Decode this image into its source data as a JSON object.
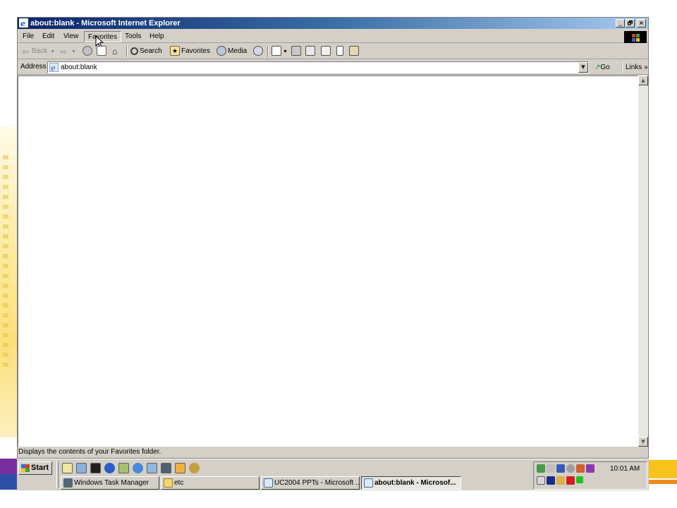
{
  "window": {
    "title": "about:blank - Microsoft Internet Explorer",
    "controls": {
      "minimize": "_",
      "maximize": "🗗",
      "close": "×"
    }
  },
  "menu": {
    "items": [
      {
        "label": "File"
      },
      {
        "label": "Edit"
      },
      {
        "label": "View"
      },
      {
        "label": "Favorites",
        "active": true
      },
      {
        "label": "Tools"
      },
      {
        "label": "Help"
      }
    ]
  },
  "toolbar": {
    "back": "Back",
    "search": "Search",
    "favorites": "Favorites",
    "media": "Media"
  },
  "address": {
    "label": "Address",
    "value": "about:blank",
    "go": "Go",
    "links": "Links"
  },
  "status": {
    "text": "Displays the contents of your Favorites folder."
  },
  "taskbar": {
    "start": "Start",
    "tasks": [
      {
        "label": "Windows Task Manager"
      },
      {
        "label": "etc"
      },
      {
        "label": "UC2004 PPTs - Microsoft ..."
      },
      {
        "label": "about:blank - Microsof...",
        "active": true
      }
    ],
    "clock": "10:01 AM"
  },
  "colors": {
    "titlebar_start": "#0a246a",
    "titlebar_end": "#a6caf0",
    "chrome": "#d4d0c8",
    "deco_purple": "#7a2f9f",
    "deco_blue": "#2d4fa8",
    "deco_yellow": "#f7c21c",
    "deco_orange": "#f08a1c"
  }
}
